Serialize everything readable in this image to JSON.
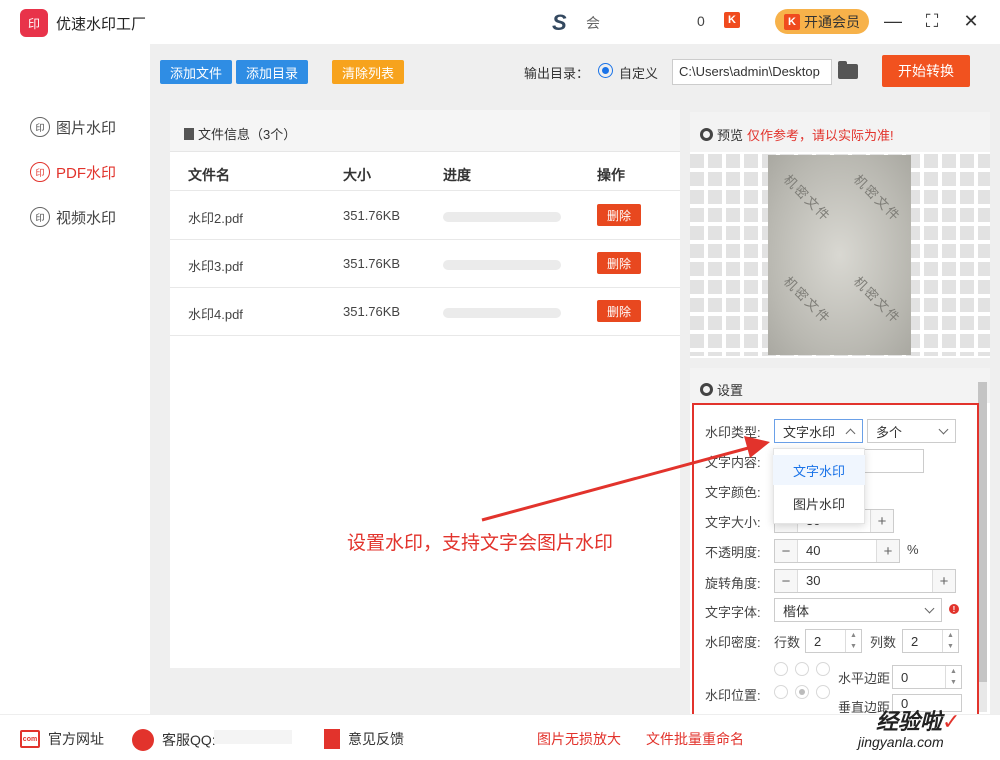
{
  "app": {
    "logo_text": "印",
    "title": "优速水印工厂"
  },
  "header": {
    "brand_mark": "S",
    "member_text": "会",
    "coin_count": "0",
    "coin_icon": "K",
    "vip_label": "开通会员",
    "vip_icon": "K"
  },
  "window_controls": {
    "minimize": "—",
    "maximize": "⛶",
    "close": "✕"
  },
  "sidebar": {
    "items": [
      {
        "icon_text": "印",
        "label": "图片水印",
        "active": false
      },
      {
        "icon_text": "印",
        "label": "PDF水印",
        "active": true
      },
      {
        "icon_text": "印",
        "label": "视频水印",
        "active": false
      }
    ]
  },
  "toolbar": {
    "add_file": "添加文件",
    "add_dir": "添加目录",
    "clear_list": "清除列表",
    "output_label": "输出目录：",
    "radio_label": "自定义",
    "output_path": "C:\\Users\\admin\\Desktop",
    "start_button": "开始转换",
    "colors": {
      "blue": "#2f8de4",
      "orange": "#f7a31d",
      "red": "#f1521f"
    }
  },
  "file_panel": {
    "title": "文件信息（3个）",
    "columns": [
      "文件名",
      "大小",
      "进度",
      "操作"
    ],
    "rows": [
      {
        "name": "水印2.pdf",
        "size": "351.76KB",
        "progress": 0,
        "action": "删除"
      },
      {
        "name": "水印3.pdf",
        "size": "351.76KB",
        "progress": 0,
        "action": "删除"
      },
      {
        "name": "水印4.pdf",
        "size": "351.76KB",
        "progress": 0,
        "action": "删除"
      }
    ]
  },
  "preview": {
    "title": "预览",
    "warning": "仅作参考，请以实际为准!",
    "watermark_text": "机密文件"
  },
  "settings": {
    "title": "设置",
    "watermark_type_label": "水印类型:",
    "watermark_type_value": "文字水印",
    "count_mode_value": "多个",
    "dropdown_options": [
      "文字水印",
      "图片水印"
    ],
    "text_content_label": "文字内容:",
    "text_color_label": "文字颜色:",
    "font_size_label": "文字大小:",
    "font_size_value": "30",
    "opacity_label": "不透明度:",
    "opacity_value": "40",
    "opacity_unit": "%",
    "rotation_label": "旋转角度:",
    "rotation_value": "30",
    "font_label": "文字字体:",
    "font_value": "楷体",
    "density_label": "水印密度:",
    "rows_label": "行数",
    "rows_value": "2",
    "cols_label": "列数",
    "cols_value": "2",
    "position_label": "水印位置:",
    "h_margin_label": "水平边距",
    "h_margin_value": "0",
    "v_margin_label": "垂直边距",
    "v_margin_value": "0",
    "stepper_minus": "−",
    "stepper_plus": "+",
    "alert_icon": "!"
  },
  "annotation": {
    "text": "设置水印，支持文字会图片水印",
    "color": "#e2332c"
  },
  "footer": {
    "website": "官方网址",
    "website_icon": "com",
    "qq_label": "客服QQ:",
    "feedback": "意见反馈",
    "image_enlarge": "图片无损放大",
    "batch_rename": "文件批量重命名"
  },
  "overlay_watermark": {
    "brand": "经验啦",
    "check": "✓",
    "url": "jingyanla.com"
  }
}
